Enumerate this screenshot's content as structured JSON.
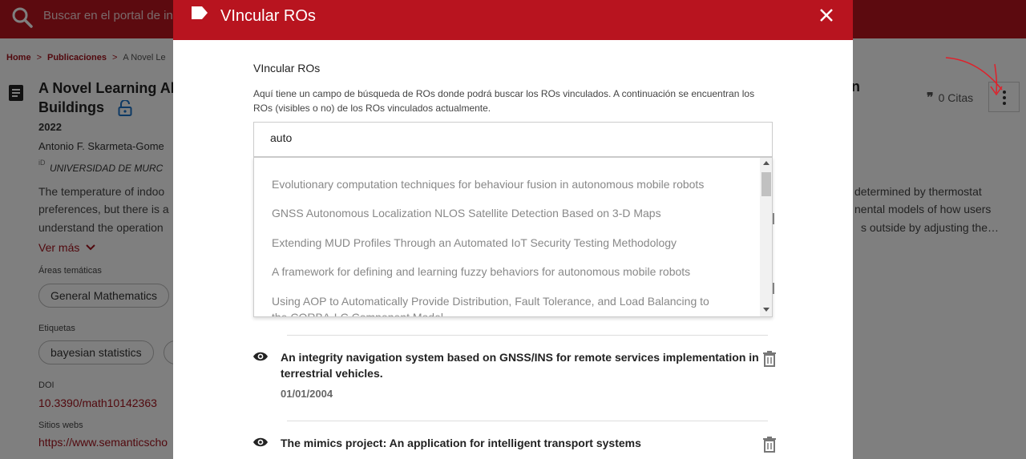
{
  "search": {
    "placeholder": "Buscar en el portal de in"
  },
  "breadcrumb": {
    "home": "Home",
    "sep1": ">",
    "publicaciones": "Publicaciones",
    "sep2": ">",
    "current": "A Novel Le"
  },
  "publication": {
    "title_line1": "A Novel Learning Al",
    "title_line2": "Buildings",
    "title_right_fragment": "n",
    "year": "2022",
    "author": "Antonio F. Skarmeta-Gome",
    "orcid_mark": "iD",
    "affiliation": "UNIVERSIDAD DE MURC",
    "abstract_left": [
      "The temperature of indoo",
      "preferences, but there is a",
      "understand the operation"
    ],
    "abstract_right": [
      "determined by thermostat",
      "nental models of how users",
      "s outside by adjusting the…"
    ],
    "ver_mas": "Ver más",
    "areas_label": "Áreas temáticas",
    "area_chip": "General Mathematics",
    "etiquetas_label": "Etiquetas",
    "tag_chip": "bayesian statistics",
    "doi_label": "DOI",
    "doi": "10.3390/math10142363",
    "sitios_label": "Sitios webs",
    "sitio": "https://www.semanticscho",
    "citas": "0 Citas",
    "citas_icon": "quote-icon"
  },
  "modal": {
    "title": "VIncular ROs",
    "field_title": "VIncular ROs",
    "help_text": "Aquí tiene un campo de búsqueda de ROs donde podrá buscar los ROs vinculados. A continuación se encuentran los ROs (visibles o no) de los ROs vinculados actualmente.",
    "search_value": "auto",
    "suggestions": [
      "Evolutionary computation techniques for behaviour fusion in autonomous mobile robots",
      "GNSS Autonomous Localization NLOS Satellite Detection Based on 3-D Maps",
      "Extending MUD Profiles Through an Automated IoT Security Testing Methodology",
      "A framework for defining and learning fuzzy behaviors for autonomous mobile robots",
      "Using AOP to Automatically Provide Distribution, Fault Tolerance, and Load Balancing to",
      "the CORBA-LC Component Model"
    ],
    "linked_ros": [
      {
        "title": "An integrity navigation system based on GNSS/INS for remote services implementation in terrestrial vehicles.",
        "date": "01/01/2004"
      },
      {
        "title": "The mimics project: An application for intelligent transport systems",
        "date": ""
      }
    ]
  },
  "colors": {
    "brand": "#b8141f",
    "link": "#a3121c",
    "annotation": "#e0202a"
  }
}
